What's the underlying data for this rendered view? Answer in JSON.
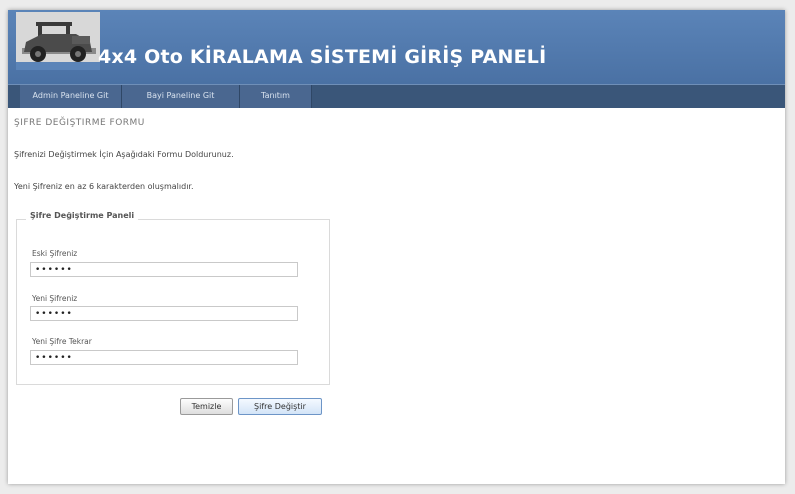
{
  "header": {
    "title": "4x4 Oto KİRALAMA SİSTEMİ GİRİŞ PANELİ",
    "logo_icon": "jeep-logo-icon"
  },
  "nav": {
    "items": [
      {
        "label": "Admin Paneline Git"
      },
      {
        "label": "Bayi Paneline Git"
      },
      {
        "label": "Tanıtım"
      }
    ]
  },
  "main": {
    "page_title": "Şifre Değiştirme Formu",
    "info_1": "Şifrenizi Değiştirmek İçin Aşağıdaki Formu Doldurunuz.",
    "info_2": "Yeni Şifreniz en az 6 karakterden oluşmalıdır.",
    "panel": {
      "legend": "Şifre Değiştirme Paneli",
      "fields": [
        {
          "label": "Eski Şifreniz",
          "value": "••••••"
        },
        {
          "label": "Yeni Şifreniz",
          "value": "••••••"
        },
        {
          "label": "Yeni Şifre Tekrar",
          "value": "••••••"
        }
      ]
    },
    "buttons": {
      "reset": "Temizle",
      "submit": "Şifre Değiştir"
    }
  },
  "colors": {
    "header_blue": "#4f77aa",
    "nav_blue": "#3a5679"
  }
}
